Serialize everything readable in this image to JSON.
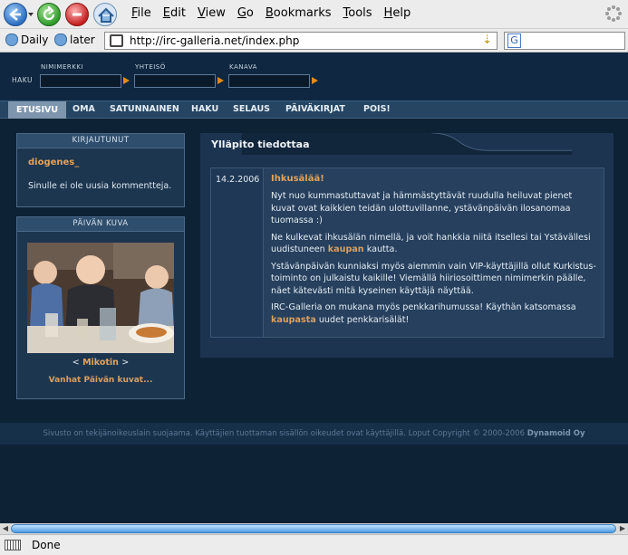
{
  "browser": {
    "menus": [
      {
        "label": "File",
        "key": "F"
      },
      {
        "label": "Edit",
        "key": "E"
      },
      {
        "label": "View",
        "key": "V"
      },
      {
        "label": "Go",
        "key": "G"
      },
      {
        "label": "Bookmarks",
        "key": "B"
      },
      {
        "label": "Tools",
        "key": "T"
      },
      {
        "label": "Help",
        "key": "H"
      }
    ],
    "bookmarks": [
      "Daily",
      "later"
    ],
    "url": "http://irc-galleria.net/index.php",
    "status": "Done"
  },
  "header": {
    "search_label": "HAKU",
    "fields": [
      "NIMIMERKKI",
      "YHTEISÖ",
      "KANAVA"
    ]
  },
  "nav": [
    "ETUSIVU",
    "OMA",
    "SATUNNAINEN",
    "HAKU",
    "SELAUS",
    "PÄIVÄKIRJAT",
    "POIS!"
  ],
  "login_box": {
    "title": "KIRJAUTUNUT",
    "username": "diogenes_",
    "message": "Sinulle ei ole uusia kommentteja."
  },
  "photo_box": {
    "title": "PÄIVÄN KUVA",
    "prev": "<",
    "caption_name": "Mikotin",
    "next": ">",
    "older_link": "Vanhat Päivän kuvat..."
  },
  "announcement": {
    "title": "Ylläpito tiedottaa",
    "date": "14.2.2006",
    "heading": "Ihkusälää!",
    "p1": "Nyt nuo kummastuttavat ja hämmästyttävät ruudulla heiluvat pienet kuvat ovat kaikkien teidän ulottuvillanne, ystävänpäivän ilosanomaa tuomassa :)",
    "p2a": "Ne kulkevat ihkusälän nimellä, ja voit hankkia niitä itsellesi tai Ystävällesi uudistuneen ",
    "p2link": "kaupan",
    "p2b": " kautta.",
    "p3": "Ystävänpäivän kunniaksi myös aiemmin vain VIP-käyttäjillä ollut Kurkistus-toiminto on julkaistu kaikille! Viemällä hiiriosoittimen nimimerkin päälle, näet kätevästi mitä kyseinen käyttäjä näyttää.",
    "p4a": "IRC-Galleria on mukana myös penkkarihumussa! Käythän katsomassa ",
    "p4link": "kaupasta",
    "p4b": " uudet penkkarisälät!"
  },
  "footer": {
    "text": "Sivusto on tekijänoikeuslain suojaama. Käyttäjien tuottaman sisällön oikeudet ovat käyttäjillä. Loput Copyright © 2000-2006 ",
    "company": "Dynamoid Oy"
  },
  "colors": {
    "accent": "#e3a35a",
    "page_bg": "#0e2236",
    "nav_bg": "#254563",
    "arrow": "#e58a18"
  }
}
